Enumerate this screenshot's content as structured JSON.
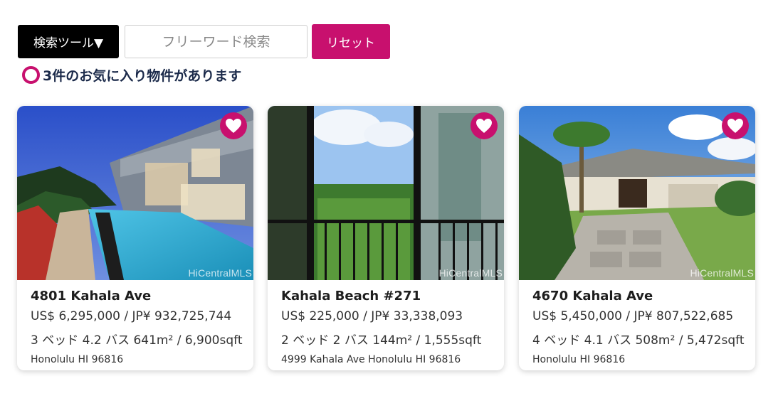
{
  "toolbar": {
    "search_tools_label": "検索ツール▼",
    "search_placeholder": "フリーワード検索",
    "search_value": "",
    "reset_label": "リセット"
  },
  "favorites_summary": "3件のお気に入り物件があります",
  "colors": {
    "accent": "#c8106e",
    "heading": "#1b2a4a",
    "dark_button": "#000000"
  },
  "listings": [
    {
      "title": "4801 Kahala Ave",
      "price": "US$ 6,295,000 / JP¥ 932,725,744",
      "specs": "3 ベッド 4.2 バス 641m² / 6,900sqft",
      "address": "Honolulu HI 96816",
      "watermark": "HiCentralMLS",
      "favorite_icon": "heart-icon"
    },
    {
      "title": "Kahala Beach #271",
      "price": "US$ 225,000 / JP¥ 33,338,093",
      "specs": "2 ベッド 2 バス 144m² / 1,555sqft",
      "address": "4999 Kahala Ave Honolulu HI 96816",
      "watermark": "HiCentralMLS",
      "favorite_icon": "heart-icon"
    },
    {
      "title": "4670 Kahala Ave",
      "price": "US$ 5,450,000 / JP¥ 807,522,685",
      "specs": "4 ベッド 4.1 バス 508m² / 5,472sqft",
      "address": "Honolulu HI 96816",
      "watermark": "HiCentralMLS",
      "favorite_icon": "heart-icon"
    }
  ]
}
